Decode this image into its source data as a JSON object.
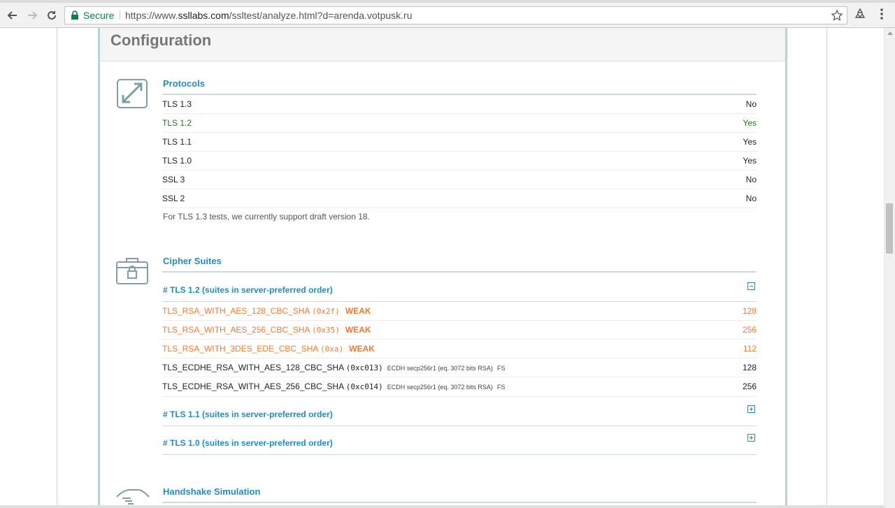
{
  "browser": {
    "secure_label": "Secure",
    "url_prefix": "https://www.",
    "url_host": "ssllabs.com",
    "url_path": "/ssltest/analyze.html?d=arenda.votpusk.ru"
  },
  "panel": {
    "title": "Configuration"
  },
  "protocols": {
    "title": "Protocols",
    "rows": [
      {
        "name": "TLS 1.3",
        "value": "No"
      },
      {
        "name": "TLS 1.2",
        "value": "Yes"
      },
      {
        "name": "TLS 1.1",
        "value": "Yes"
      },
      {
        "name": "TLS 1.0",
        "value": "Yes"
      },
      {
        "name": "SSL 3",
        "value": "No"
      },
      {
        "name": "SSL 2",
        "value": "No"
      }
    ],
    "note": "For TLS 1.3 tests, we currently support draft version 18."
  },
  "ciphers": {
    "title": "Cipher Suites",
    "groups": [
      {
        "label": "# TLS 1.2 (suites in server-preferred order)",
        "state": "expanded"
      },
      {
        "label": "# TLS 1.1 (suites in server-preferred order)",
        "state": "collapsed"
      },
      {
        "label": "# TLS 1.0 (suites in server-preferred order)",
        "state": "collapsed"
      }
    ],
    "suites": [
      {
        "name": "TLS_RSA_WITH_AES_128_CBC_SHA",
        "code": "(0x2f)",
        "flag": "WEAK",
        "extra": "",
        "fs": "",
        "bits": "128"
      },
      {
        "name": "TLS_RSA_WITH_AES_256_CBC_SHA",
        "code": "(0x35)",
        "flag": "WEAK",
        "extra": "",
        "fs": "",
        "bits": "256"
      },
      {
        "name": "TLS_RSA_WITH_3DES_EDE_CBC_SHA",
        "code": "(0xa)",
        "flag": "WEAK",
        "extra": "",
        "fs": "",
        "bits": "112"
      },
      {
        "name": "TLS_ECDHE_RSA_WITH_AES_128_CBC_SHA",
        "code": "(0xc013)",
        "flag": "",
        "extra": "ECDH secp256r1 (eq. 3072 bits RSA)",
        "fs": "FS",
        "bits": "128"
      },
      {
        "name": "TLS_ECDHE_RSA_WITH_AES_256_CBC_SHA",
        "code": "(0xc014)",
        "flag": "",
        "extra": "ECDH secp256r1 (eq. 3072 bits RSA)",
        "fs": "FS",
        "bits": "256"
      }
    ]
  },
  "handshake": {
    "title": "Handshake Simulation"
  },
  "colors": {
    "link_blue": "#1f8dc3",
    "weak_orange": "#f07a30",
    "ok_green": "#1d7a1d",
    "panel_border": "#b7d3d4"
  },
  "icons": {
    "protocols": "expand-arrows-icon",
    "ciphers": "locked-briefcase-icon",
    "handshake": "handshake-icon"
  }
}
